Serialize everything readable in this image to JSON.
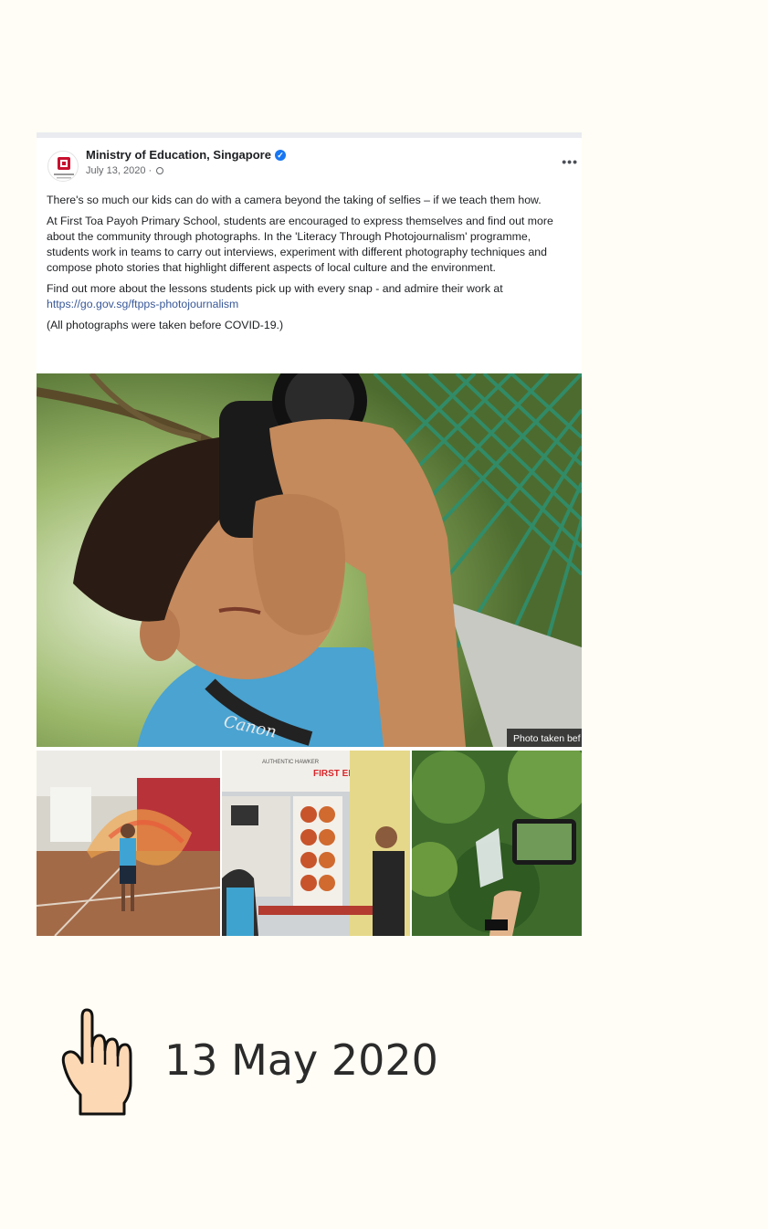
{
  "post": {
    "author": "Ministry of Education, Singapore",
    "verified_icon": "verified-badge-icon",
    "date": "July 13, 2020",
    "date_separator": " · ",
    "more_label": "•••",
    "paragraphs": [
      "There's so much our kids can do with a camera beyond the taking of selfies – if we teach them how.",
      "At First Toa Payoh Primary School, students are encouraged to express themselves and find out more about the community through photographs. In the 'Literacy Through Photojournalism' programme, students work in teams to carry out interviews, experiment with different photography techniques and compose photo stories that highlight different aspects of local culture and the environment."
    ],
    "cta_text": "Find out more about the lessons students pick up with every snap - and admire their work at",
    "link": "https://go.gov.sg/ftpps-photojournalism",
    "note": "(All photographs were taken before COVID-19.)",
    "photo_caption": "Photo taken bef",
    "camera_brand": "Canon",
    "thumb_sign_1": "FIRST EDITION",
    "thumb_sign_2": "AUTHENTIC HAWKER"
  },
  "footer": {
    "pointer_icon": "pointing-hand-icon",
    "date": "13 May 2020"
  },
  "colors": {
    "page_bg": "#fffdf5",
    "link": "#385898",
    "verified": "#1877f2"
  }
}
